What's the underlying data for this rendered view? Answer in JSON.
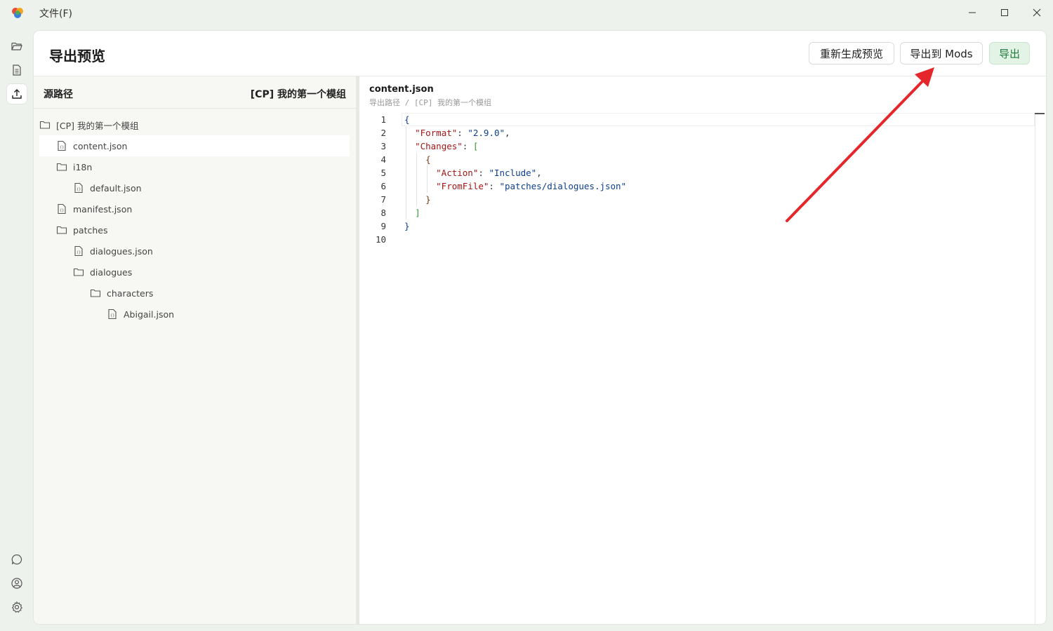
{
  "titlebar": {
    "menu_file": "文件(F)"
  },
  "page": {
    "title": "导出预览",
    "buttons": {
      "regenerate": "重新生成预览",
      "export_mods": "导出到 Mods",
      "export": "导出"
    }
  },
  "left_pane": {
    "title": "源路径",
    "project": "[CP] 我的第一个模组",
    "tree": [
      {
        "label": "[CP] 我的第一个模组",
        "type": "folder",
        "depth": 0
      },
      {
        "label": "content.json",
        "type": "file",
        "depth": 1
      },
      {
        "label": "i18n",
        "type": "folder",
        "depth": 1
      },
      {
        "label": "default.json",
        "type": "file",
        "depth": 2
      },
      {
        "label": "manifest.json",
        "type": "file",
        "depth": 1
      },
      {
        "label": "patches",
        "type": "folder",
        "depth": 1
      },
      {
        "label": "dialogues.json",
        "type": "file",
        "depth": 2
      },
      {
        "label": "dialogues",
        "type": "folder",
        "depth": 2
      },
      {
        "label": "characters",
        "type": "folder",
        "depth": 3
      },
      {
        "label": "Abigail.json",
        "type": "file",
        "depth": 4
      }
    ]
  },
  "right_pane": {
    "file_name": "content.json",
    "path": "导出路径 / [CP] 我的第一个模组"
  },
  "editor": {
    "line_numbers": [
      "1",
      "2",
      "3",
      "4",
      "5",
      "6",
      "7",
      "8",
      "9",
      "10"
    ],
    "tokens": {
      "l1_open": "{",
      "format_key": "\"Format\"",
      "format_val": "\"2.9.0\"",
      "changes_key": "\"Changes\"",
      "arr_open": "[",
      "obj_open": "{",
      "action_key": "\"Action\"",
      "action_val": "\"Include\"",
      "fromfile_key": "\"FromFile\"",
      "fromfile_val": "\"patches/dialogues.json\"",
      "obj_close": "}",
      "arr_close": "]",
      "l1_close": "}",
      "colon": ": ",
      "comma": ","
    }
  },
  "colors": {
    "accent": "#1e7a3a",
    "arrow": "#e5262b"
  },
  "icons": {
    "rail_top": [
      "folder-open-icon",
      "document-icon",
      "upload-icon"
    ],
    "rail_bottom": [
      "chat-icon",
      "user-circle-icon",
      "gear-icon"
    ]
  }
}
